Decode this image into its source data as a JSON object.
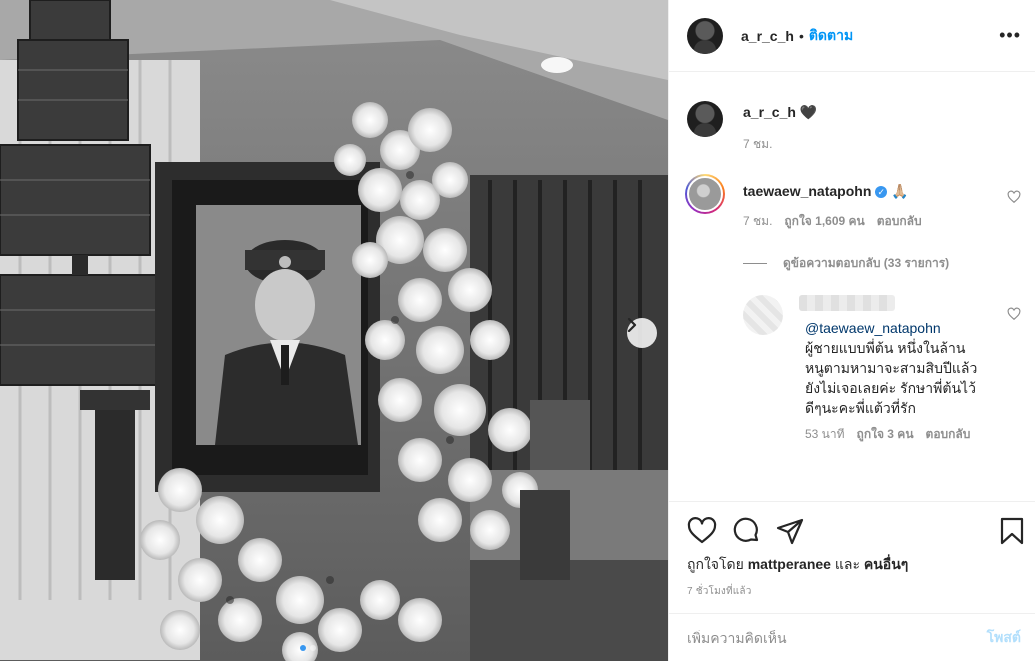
{
  "post": {
    "username": "a_r_c_h",
    "separator": "•",
    "follow_label": "ติดตาม",
    "more_label": "•••"
  },
  "caption": {
    "username": "a_r_c_h",
    "text": "🖤",
    "time": "7 ชม."
  },
  "comment": {
    "username": "taewaew_natapohn",
    "verified_glyph": "✓",
    "text": "🙏🏼",
    "time": "7 ชม.",
    "likes": "ถูกใจ 1,609 คน",
    "reply_label": "ตอบกลับ",
    "view_replies": "ดูข้อความตอบกลับ (33 รายการ)"
  },
  "reply": {
    "mention": "@taewaew_natapohn",
    "text": "ผู้ชายแบบพี่ต้น หนึ่งในล้าน หนูตามหามาจะสามสิบปีแล้ว ยังไม่เจอเลยค่ะ รักษาพี่ต้นไว้ดีๆนะคะพี่แต้วที่รัก",
    "time": "53 นาที",
    "likes": "ถูกใจ 3 คน",
    "reply_label": "ตอบกลับ"
  },
  "actions": {
    "icons": [
      "heart-icon",
      "comment-icon",
      "share-icon",
      "bookmark-icon"
    ],
    "liked_by_prefix": "ถูกใจโดย ",
    "liked_by_user": "mattperanee",
    "liked_by_and": " และ ",
    "liked_by_others": "คนอื่นๆ",
    "timestamp": "7 ชั่วโมงที่แล้ว"
  },
  "composer": {
    "placeholder": "เพิ่มความคิดเห็น",
    "post_label": "โพสต์"
  },
  "carousel": {
    "next_icon": "chevron-right-icon",
    "dot_count": 2,
    "active_dot": 0
  },
  "colors": {
    "link_blue": "#0095f6",
    "verified_blue": "#3897f0",
    "muted": "#8e8e8e",
    "post_disabled": "#b2dffc"
  }
}
